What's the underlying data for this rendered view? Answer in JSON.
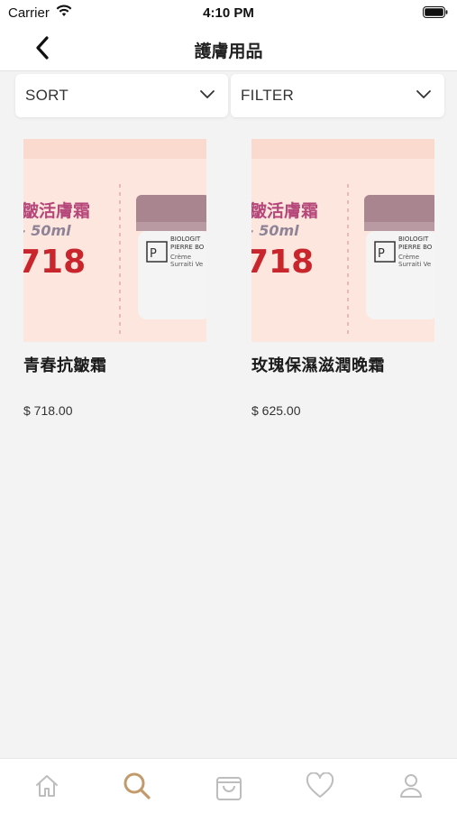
{
  "status_bar": {
    "carrier": "Carrier",
    "time": "4:10 PM"
  },
  "nav": {
    "title": "護膚用品",
    "back_icon": "chevron-left-icon"
  },
  "controls": {
    "sort_label": "SORT",
    "filter_label": "FILTER"
  },
  "products": [
    {
      "name": "青春抗皺霜",
      "price": "$ 718.00",
      "image": {
        "line1": "皺活膚霜",
        "line2": "- 50ml",
        "line3": "718",
        "jar_brand": "BIOLOGIT",
        "jar_line2": "PIERRE BO",
        "jar_line3": "Crème",
        "jar_line4": "Surraiti Ve"
      }
    },
    {
      "name": "玫瑰保濕滋潤晚霜",
      "price": "$ 625.00",
      "image": {
        "line1": "皺活膚霜",
        "line2": "- 50ml",
        "line3": "718",
        "jar_brand": "BIOLOGIT",
        "jar_line2": "PIERRE BO",
        "jar_line3": "Crème",
        "jar_line4": "Surraiti Ve"
      }
    }
  ],
  "tab_bar": {
    "items": [
      "home-icon",
      "search-icon",
      "shopping-bag-icon",
      "heart-icon",
      "user-icon"
    ],
    "active": "search-icon",
    "active_color": "#c39a6b",
    "inactive_color": "#bdbdbd"
  }
}
